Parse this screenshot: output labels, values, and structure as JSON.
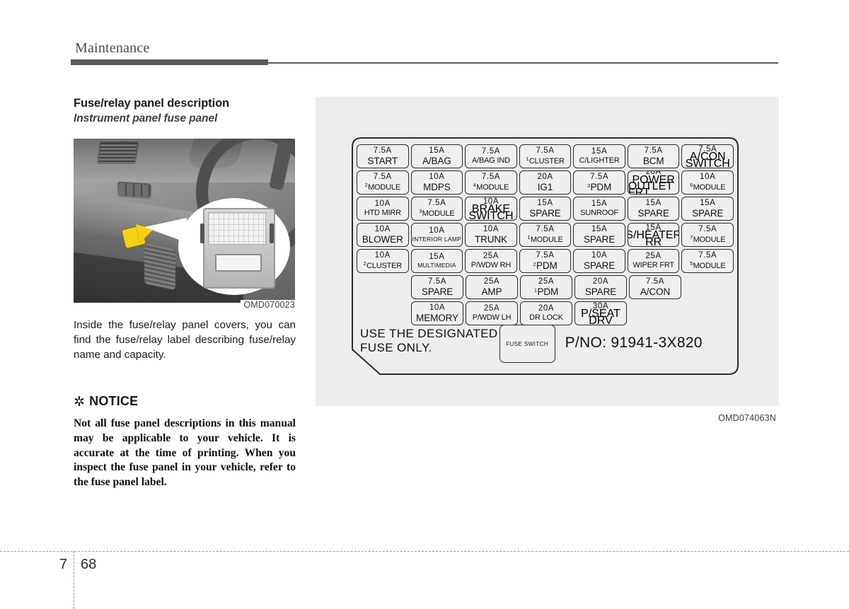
{
  "header": {
    "chapter_title": "Maintenance"
  },
  "left": {
    "section_heading": "Fuse/relay panel description",
    "sub_heading": "Instrument panel fuse panel",
    "photo_caption": "OMD070023",
    "body_paragraph": "Inside the fuse/relay panel covers, you can find the fuse/relay label describing fuse/relay name and capacity.",
    "notice": {
      "asterisk": "✲",
      "heading": "NOTICE",
      "text": "Not all fuse panel descriptions in this manual may be applicable to your vehicle. It is accurate at the time of printing. When you inspect the fuse panel in your vehicle, refer to the fuse panel label."
    }
  },
  "fuse_panel": {
    "caption": "OMD074063N",
    "designated_text": "USE THE DESIGNATED\nFUSE ONLY.",
    "fuse_switch_label": "FUSE SWITCH",
    "part_number": "P/NO: 91941-3X820",
    "rows": [
      [
        {
          "amp": "7.5A",
          "name": "START",
          "sup": "",
          "size": "md"
        },
        {
          "amp": "15A",
          "name": "A/BAG",
          "sup": "",
          "size": "md"
        },
        {
          "amp": "7.5A",
          "name": "A/BAG IND",
          "sup": "",
          "size": "sm"
        },
        {
          "amp": "7.5A",
          "name": "CLUSTER",
          "sup": "1",
          "size": "sm"
        },
        {
          "amp": "15A",
          "name": "C/LIGHTER",
          "sup": "",
          "size": "sm"
        },
        {
          "amp": "7.5A",
          "name": "BCM",
          "sup": "",
          "size": "md"
        },
        {
          "amp": "7.5A",
          "name": "A/CON SWITCH",
          "sup": "",
          "size": "xs2",
          "lines": [
            "A/CON",
            "SWITCH"
          ]
        }
      ],
      [
        {
          "amp": "7.5A",
          "name": "MODULE",
          "sup": "2",
          "size": "sm"
        },
        {
          "amp": "10A",
          "name": "MDPS",
          "sup": "",
          "size": "md"
        },
        {
          "amp": "7.5A",
          "name": "MODULE",
          "sup": "4",
          "size": "sm"
        },
        {
          "amp": "20A",
          "name": "IG1",
          "sup": "",
          "size": "md"
        },
        {
          "amp": "7.5A",
          "name": "PDM",
          "sup": "3",
          "size": "md"
        },
        {
          "amp": "20A",
          "name": "POWER OUTLET FRT",
          "sup": "",
          "size": "xs2",
          "lines": [
            "POWER",
            "OUTLET FRT"
          ],
          "amp_tight": true
        },
        {
          "amp": "10A",
          "name": "MODULE",
          "sup": "6",
          "size": "sm"
        }
      ],
      [
        {
          "amp": "10A",
          "name": "HTD MIRR",
          "sup": "",
          "size": "sm"
        },
        {
          "amp": "7.5A",
          "name": "MODULE",
          "sup": "3",
          "size": "sm"
        },
        {
          "amp": "10A",
          "name": "BRAKE SWITCH",
          "sup": "",
          "size": "xs2",
          "lines": [
            "BRAKE",
            "SWITCH"
          ]
        },
        {
          "amp": "15A",
          "name": "SPARE",
          "sup": "",
          "size": "md"
        },
        {
          "amp": "15A",
          "name": "SUNROOF",
          "sup": "",
          "size": "sm"
        },
        {
          "amp": "15A",
          "name": "SPARE",
          "sup": "",
          "size": "md"
        },
        {
          "amp": "15A",
          "name": "SPARE",
          "sup": "",
          "size": "md"
        }
      ],
      [
        {
          "amp": "10A",
          "name": "BLOWER",
          "sup": "",
          "size": "md"
        },
        {
          "amp": "10A",
          "name": "INTERIOR LAMP",
          "sup": "",
          "size": "xs"
        },
        {
          "amp": "10A",
          "name": "TRUNK",
          "sup": "",
          "size": "md"
        },
        {
          "amp": "7.5A",
          "name": "MODULE",
          "sup": "1",
          "size": "sm"
        },
        {
          "amp": "15A",
          "name": "SPARE",
          "sup": "",
          "size": "md"
        },
        {
          "amp": "15A",
          "name": "S/HEATER RR",
          "sup": "",
          "size": "xs2",
          "lines": [
            "S/HEATER",
            "RR"
          ]
        },
        {
          "amp": "7.5A",
          "name": "MODULE",
          "sup": "7",
          "size": "sm"
        }
      ],
      [
        {
          "amp": "10A",
          "name": "CLUSTER",
          "sup": "2",
          "size": "sm"
        },
        {
          "amp": "15A",
          "name": "MULTIMEDIA",
          "sup": "",
          "size": "xs"
        },
        {
          "amp": "25A",
          "name": "P/WDW RH",
          "sup": "",
          "size": "sm"
        },
        {
          "amp": "7.5A",
          "name": "PDM",
          "sup": "2",
          "size": "md"
        },
        {
          "amp": "10A",
          "name": "SPARE",
          "sup": "",
          "size": "md"
        },
        {
          "amp": "25A",
          "name": "WIPER FRT",
          "sup": "",
          "size": "sm"
        },
        {
          "amp": "7.5A",
          "name": "MODULE",
          "sup": "5",
          "size": "sm"
        }
      ],
      [
        {
          "offset": true
        },
        {
          "amp": "7.5A",
          "name": "SPARE",
          "sup": "",
          "size": "md"
        },
        {
          "amp": "25A",
          "name": "AMP",
          "sup": "",
          "size": "md"
        },
        {
          "amp": "25A",
          "name": "PDM",
          "sup": "1",
          "size": "md"
        },
        {
          "amp": "20A",
          "name": "SPARE",
          "sup": "",
          "size": "md"
        },
        {
          "amp": "7.5A",
          "name": "A/CON",
          "sup": "",
          "size": "md"
        }
      ],
      [
        {
          "offset": true
        },
        {
          "amp": "10A",
          "name": "MEMORY",
          "sup": "",
          "size": "md"
        },
        {
          "amp": "25A",
          "name": "P/WDW LH",
          "sup": "",
          "size": "sm"
        },
        {
          "amp": "20A",
          "name": "DR LOCK",
          "sup": "",
          "size": "sm"
        },
        {
          "amp": "30A",
          "name": "P/SEAT DRV",
          "sup": "",
          "size": "xs2",
          "lines": [
            "P/SEAT",
            "DRV"
          ]
        }
      ]
    ]
  },
  "footer": {
    "chapter": "7",
    "page": "68"
  }
}
